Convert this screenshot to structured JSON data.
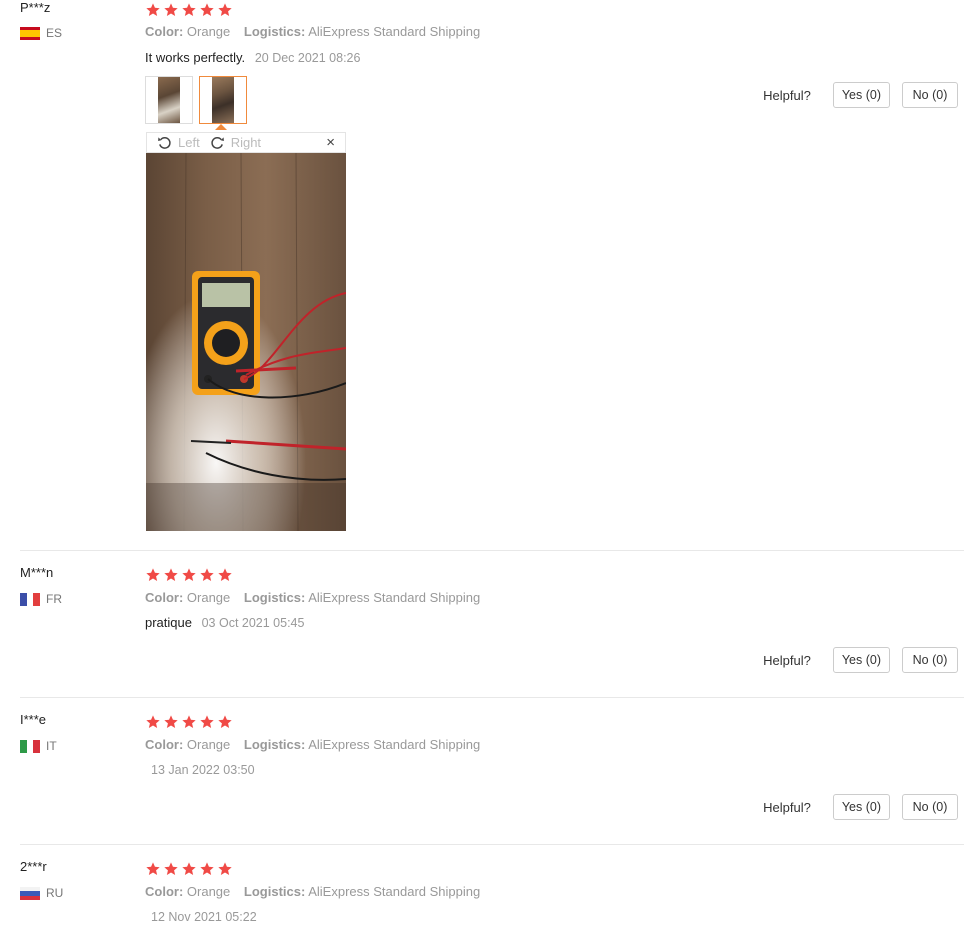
{
  "reviews": [
    {
      "user": "P***z",
      "country": "ES",
      "stars": 5,
      "color_key": "Color:",
      "color_val": "Orange",
      "logistics_key": "Logistics:",
      "logistics_val": "AliExpress Standard Shipping",
      "text": "It works perfectly.",
      "date": "20 Dec 2021 08:26",
      "helpful_label": "Helpful?",
      "yes_label": "Yes (0)",
      "no_label": "No (0)"
    },
    {
      "user": "M***n",
      "country": "FR",
      "stars": 5,
      "color_key": "Color:",
      "color_val": "Orange",
      "logistics_key": "Logistics:",
      "logistics_val": "AliExpress Standard Shipping",
      "text": "pratique",
      "date": "03 Oct 2021 05:45",
      "helpful_label": "Helpful?",
      "yes_label": "Yes (0)",
      "no_label": "No (0)"
    },
    {
      "user": "I***e",
      "country": "IT",
      "stars": 5,
      "color_key": "Color:",
      "color_val": "Orange",
      "logistics_key": "Logistics:",
      "logistics_val": "AliExpress Standard Shipping",
      "text": "",
      "date": "13 Jan 2022 03:50",
      "helpful_label": "Helpful?",
      "yes_label": "Yes (0)",
      "no_label": "No (0)"
    },
    {
      "user": "2***r",
      "country": "RU",
      "stars": 5,
      "color_key": "Color:",
      "color_val": "Orange",
      "logistics_key": "Logistics:",
      "logistics_val": "AliExpress Standard Shipping",
      "text": "",
      "date": "12 Nov 2021 05:22"
    }
  ],
  "viewer": {
    "rotate_left_label": "Left",
    "rotate_right_label": "Right",
    "close_label": "×",
    "thumbnail_count": 2,
    "active_thumbnail": 2
  },
  "colors": {
    "star": "#f04a46",
    "accent": "#f08a3c"
  },
  "icons": [
    "star-icon",
    "rotate-left-icon",
    "rotate-right-icon",
    "close-icon",
    "flag-es-icon",
    "flag-fr-icon",
    "flag-it-icon",
    "flag-ru-icon"
  ]
}
